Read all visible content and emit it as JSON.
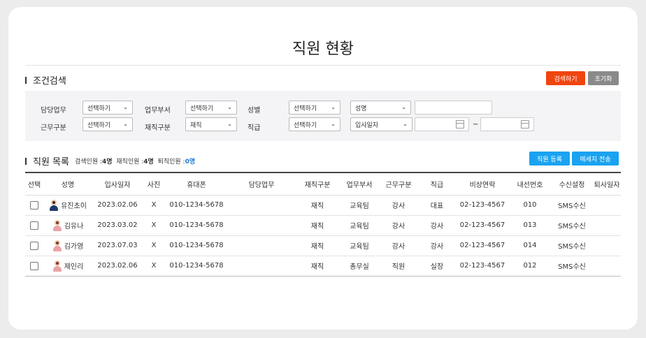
{
  "page": {
    "title": "직원 현황"
  },
  "search": {
    "section_title": "조건검색",
    "search_button": "검색하기",
    "reset_button": "초기화",
    "fields": {
      "duty_label": "담당업무",
      "duty_value": "선택하기",
      "dept_label": "업무부서",
      "dept_value": "선택하기",
      "gender_label": "성별",
      "gender_value": "선택하기",
      "name_select_value": "성명",
      "name_input_value": "",
      "worktype_label": "근무구분",
      "worktype_value": "선택하기",
      "status_label": "재직구분",
      "status_value": "재직",
      "rank_label": "직급",
      "rank_value": "선택하기",
      "date_select_value": "입사일자",
      "date_from": "",
      "date_to": "",
      "tilde": "~"
    }
  },
  "list": {
    "section_title": "직원 목록",
    "search_count_label": "검색인원 :",
    "search_count": "4명",
    "active_count_label": "재직인원 :",
    "active_count": "4명",
    "retired_count_label": "퇴직인원 :",
    "retired_count": "0명",
    "register_button": "직원 등록",
    "message_button": "메세지 전송",
    "columns": [
      "선택",
      "성명",
      "입사일자",
      "사진",
      "휴대폰",
      "담당업무",
      "재직구분",
      "업무부서",
      "근무구분",
      "직급",
      "비상연락",
      "내선번호",
      "수신설정",
      "퇴사일자"
    ],
    "rows": [
      {
        "avatar": "male-avatar-icon",
        "name": "유진초이",
        "hire_date": "2023.02.06",
        "photo": "X",
        "phone": "010-1234-5678",
        "duty": "",
        "status": "재직",
        "dept": "교육팀",
        "work_type": "강사",
        "rank": "대표",
        "emergency": "02-123-4567",
        "ext": "010",
        "receive": "SMS수신",
        "retire_date": ""
      },
      {
        "avatar": "female-avatar-icon",
        "name": "김유나",
        "hire_date": "2023.03.02",
        "photo": "X",
        "phone": "010-1234-5678",
        "duty": "",
        "status": "재직",
        "dept": "교육팀",
        "work_type": "강사",
        "rank": "강사",
        "emergency": "02-123-4567",
        "ext": "013",
        "receive": "SMS수신",
        "retire_date": ""
      },
      {
        "avatar": "female-avatar-icon",
        "name": "김가영",
        "hire_date": "2023.07.03",
        "photo": "X",
        "phone": "010-1234-5678",
        "duty": "",
        "status": "재직",
        "dept": "교육팀",
        "work_type": "강사",
        "rank": "강사",
        "emergency": "02-123-4567",
        "ext": "014",
        "receive": "SMS수신",
        "retire_date": ""
      },
      {
        "avatar": "female-avatar-icon",
        "name": "제인리",
        "hire_date": "2023.02.06",
        "photo": "X",
        "phone": "010-1234-5678",
        "duty": "",
        "status": "재직",
        "dept": "총무실",
        "work_type": "직원",
        "rank": "실장",
        "emergency": "02-123-4567",
        "ext": "012",
        "receive": "SMS수신",
        "retire_date": ""
      }
    ]
  },
  "colors": {
    "search_button": "#f0450f",
    "reset_button": "#8a8a8a",
    "primary_button": "#1aa3f0",
    "count_blue": "#1a7ad6"
  }
}
